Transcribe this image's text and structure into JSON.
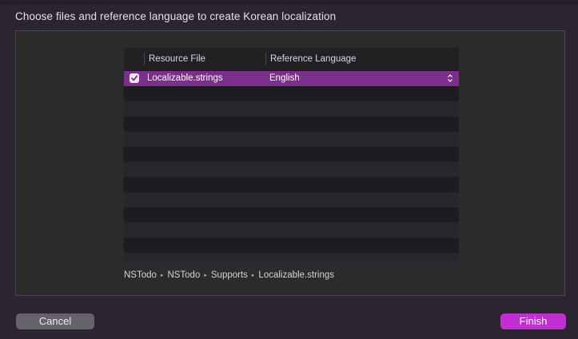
{
  "dialog": {
    "title": "Choose files and reference language to create Korean localization"
  },
  "table": {
    "columns": {
      "resource_file": "Resource File",
      "reference_language": "Reference Language"
    },
    "rows": [
      {
        "checked": true,
        "file": "Localizable.strings",
        "language": "English"
      }
    ]
  },
  "path": {
    "segments": [
      "NSTodo",
      "NSTodo",
      "Supports",
      "Localizable.strings"
    ]
  },
  "buttons": {
    "cancel": "Cancel",
    "finish": "Finish"
  },
  "colors": {
    "accent": "#c12fd3",
    "selection": "#7a2f8a"
  }
}
